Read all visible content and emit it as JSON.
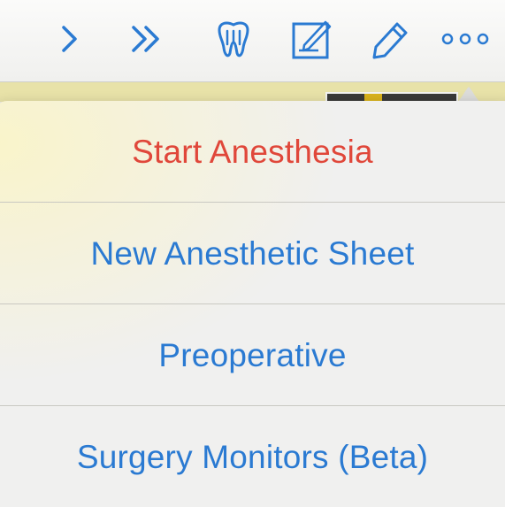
{
  "toolbar": {
    "buttons": [
      {
        "icon": "chevron-right-icon"
      },
      {
        "icon": "double-chevron-right-icon"
      },
      {
        "icon": "tooth-icon"
      },
      {
        "icon": "compose-icon"
      },
      {
        "icon": "pencil-icon"
      },
      {
        "icon": "more-icon"
      }
    ],
    "accent_color": "#2a7ad2"
  },
  "menu": {
    "items": [
      {
        "label": "Start Anesthesia",
        "style": "destructive",
        "color": "#e0473a"
      },
      {
        "label": "New Anesthetic Sheet",
        "style": "default",
        "color": "#2a7ad2"
      },
      {
        "label": "Preoperative",
        "style": "default",
        "color": "#2a7ad2"
      },
      {
        "label": "Surgery Monitors (Beta)",
        "style": "default",
        "color": "#2a7ad2"
      }
    ]
  }
}
